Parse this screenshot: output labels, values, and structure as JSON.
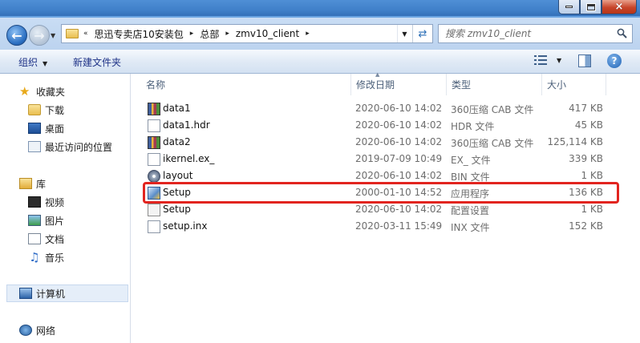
{
  "window": {
    "buttons": {
      "minimize": "minimize",
      "maximize": "maximize",
      "close": "×"
    }
  },
  "address": {
    "crumbs": [
      "«",
      "思迅专卖店10安装包",
      "总部",
      "zmv10_client"
    ],
    "separator": "▸"
  },
  "search": {
    "placeholder": "搜索 zmv10_client"
  },
  "toolbar": {
    "organize": "组织",
    "new_folder": "新建文件夹"
  },
  "nav": {
    "favorites": "收藏夹",
    "downloads": "下载",
    "desktop": "桌面",
    "recent": "最近访问的位置",
    "libraries": "库",
    "videos": "视频",
    "pictures": "图片",
    "documents": "文档",
    "music": "音乐",
    "computer": "计算机",
    "network": "网络"
  },
  "columns": {
    "name": "名称",
    "date": "修改日期",
    "type": "类型",
    "size": "大小"
  },
  "files": [
    {
      "name": "data1",
      "date": "2020-06-10 14:02",
      "type": "360压缩 CAB 文件",
      "size": "417 KB",
      "icon": "cab-archive-icon"
    },
    {
      "name": "data1.hdr",
      "date": "2020-06-10 14:02",
      "type": "HDR 文件",
      "size": "45 KB",
      "icon": "blank-file-icon"
    },
    {
      "name": "data2",
      "date": "2020-06-10 14:02",
      "type": "360压缩 CAB 文件",
      "size": "125,114 KB",
      "icon": "cab-archive-icon"
    },
    {
      "name": "ikernel.ex_",
      "date": "2019-07-09 10:49",
      "type": "EX_ 文件",
      "size": "339 KB",
      "icon": "blank-file-icon"
    },
    {
      "name": "layout",
      "date": "2020-06-10 14:02",
      "type": "BIN 文件",
      "size": "1 KB",
      "icon": "disc-image-icon"
    },
    {
      "name": "Setup",
      "date": "2000-01-10 14:52",
      "type": "应用程序",
      "size": "136 KB",
      "icon": "setup-exe-icon"
    },
    {
      "name": "Setup",
      "date": "2020-06-10 14:02",
      "type": "配置设置",
      "size": "1 KB",
      "icon": "config-settings-icon"
    },
    {
      "name": "setup.inx",
      "date": "2020-03-11 15:49",
      "type": "INX 文件",
      "size": "152 KB",
      "icon": "blank-file-icon"
    }
  ],
  "colors": {
    "highlight": "#e2241f",
    "accent": "#1e3287"
  }
}
